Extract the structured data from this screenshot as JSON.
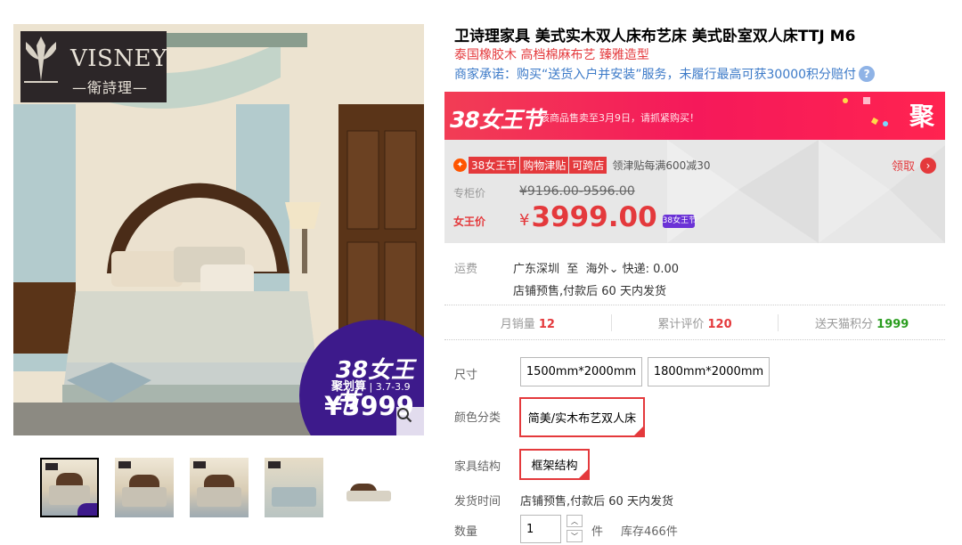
{
  "gallery": {
    "logo": {
      "brand_en": "VISNEY",
      "brand_cn": "衛詩理"
    },
    "promo": {
      "badge": "38女王节",
      "event_name": "聚划算",
      "dates": "3.7-3.9",
      "price": "¥3999"
    },
    "zoom_icon": "magnifier-icon",
    "thumbnails": [
      {
        "alt": "bedroom-overview",
        "active": true
      },
      {
        "alt": "bed-front",
        "active": false
      },
      {
        "alt": "bed-headboard",
        "active": false
      },
      {
        "alt": "bedding-detail",
        "active": false
      },
      {
        "alt": "bed-cutout",
        "active": false
      }
    ]
  },
  "product": {
    "title": "卫诗理家具 美式实木双人床布艺床 美式卧室双人床TTJ M6",
    "subtitle": "泰国橡胶木 高档棉麻布艺 臻雅造型",
    "promise": "商家承诺：购买“送货入户并安装”服务，未履行最高可获30000积分赔付",
    "help_icon": "question-icon"
  },
  "price_panel": {
    "banner_badge": "38女王节",
    "banner_text": "该商品售卖至3月9日，请抓紧购买！",
    "banner_right": "聚",
    "subsidy_tags": [
      "38女王节",
      "购物津贴",
      "可跨店"
    ],
    "subsidy_text": "领津贴每满600减30",
    "claim_label": "领取",
    "orig_label": "专柜价",
    "orig_price": "¥9196.00-9596.00",
    "queen_label": "女王价",
    "currency": "¥",
    "queen_price": "3999.00",
    "queen_badge": "38女王节"
  },
  "shipping": {
    "label": "运费",
    "from": "广东深圳",
    "to_word": "至",
    "destination": "海外",
    "express": "快递: 0.00",
    "presale": "店铺预售,付款后 60 天内发货"
  },
  "stats": {
    "monthly_sales_label": "月销量",
    "monthly_sales": "12",
    "reviews_label": "累计评价",
    "reviews": "120",
    "points_label": "送天猫积分",
    "points": "1999"
  },
  "options": {
    "size_label": "尺寸",
    "sizes": [
      "1500mm*2000mm",
      "1800mm*2000mm"
    ],
    "color_label": "颜色分类",
    "colors": [
      "简美/实木布艺双人床"
    ],
    "structure_label": "家具结构",
    "structures": [
      "框架结构"
    ],
    "delivery_label": "发货时间",
    "delivery_value": "店铺预售,付款后 60 天内发货",
    "qty_label": "数量",
    "qty_value": "1",
    "qty_unit": "件",
    "stock": "库存466件"
  }
}
